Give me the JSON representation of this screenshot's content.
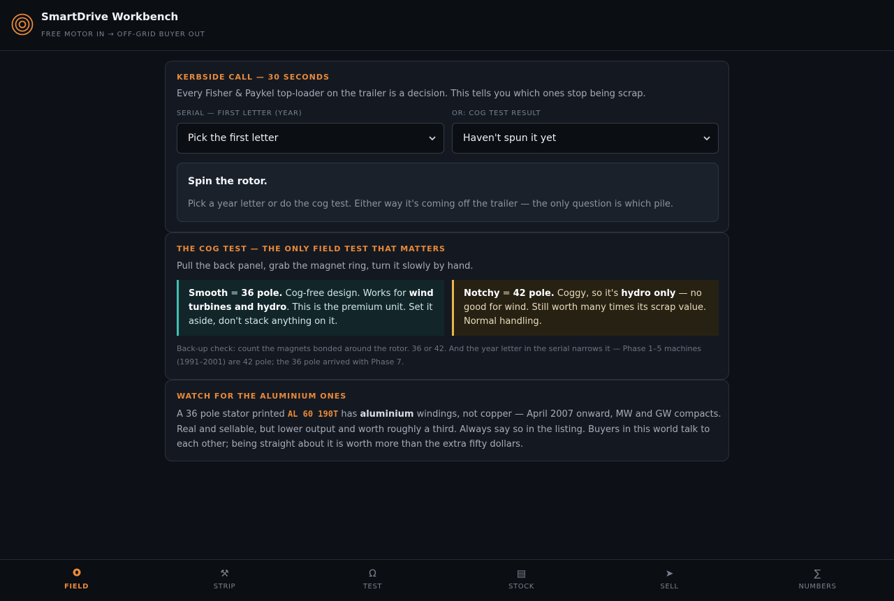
{
  "app": {
    "title": "SmartDrive Workbench",
    "subtitle": "FREE MOTOR IN → OFF-GRID BUYER OUT"
  },
  "colors": {
    "accent": "#e8893a",
    "smooth": "#3fc0b0",
    "notchy": "#e8b74a"
  },
  "kerbside": {
    "kicker": "KERBSIDE CALL — 30 SECONDS",
    "description": "Every Fisher & Paykel top-loader on the trailer is a decision. This tells you which ones stop being scrap.",
    "serial_label": "SERIAL — FIRST LETTER (YEAR)",
    "serial_value": "Pick the first letter",
    "cog_label": "OR: COG TEST RESULT",
    "cog_value": "Haven't spun it yet",
    "result_title": "Spin the rotor.",
    "result_text": "Pick a year letter or do the cog test. Either way it's coming off the trailer — the only question is which pile."
  },
  "cog_test": {
    "kicker": "THE COG TEST — THE ONLY FIELD TEST THAT MATTERS",
    "description": "Pull the back panel, grab the magnet ring, turn it slowly by hand.",
    "smooth": {
      "lead": "Smooth",
      "eq": " = ",
      "pole": "36 pole.",
      "t1": " Cog-free design. Works for ",
      "strong": "wind turbines and hydro",
      "t2": ". This is the premium unit. Set it aside, don't stack anything on it."
    },
    "notchy": {
      "lead": "Notchy",
      "eq": " = ",
      "pole": "42 pole.",
      "t1": " Coggy, so it's ",
      "strong": "hydro only",
      "t2": " — no good for wind. Still worth many times its scrap value. Normal handling."
    },
    "note": "Back-up check: count the magnets bonded around the rotor. 36 or 42. And the year letter in the serial narrows it — Phase 1–5 machines (1991–2001) are 42 pole; the 36 pole arrived with Phase 7."
  },
  "aluminium": {
    "kicker": "WATCH FOR THE ALUMINIUM ONES",
    "t1": "A 36 pole stator printed ",
    "code": "AL 60 190T",
    "t2": " has ",
    "strong": "aluminium",
    "t3": " windings, not copper — April 2007 onward, MW and GW compacts. Real and sellable, but lower output and worth roughly a third. Always say so in the listing. Buyers in this world talk to each other; being straight about it is worth more than the extra fifty dollars."
  },
  "nav": {
    "items": [
      {
        "label": "FIELD",
        "icon": "●"
      },
      {
        "label": "STRIP",
        "icon": "⚒"
      },
      {
        "label": "TEST",
        "icon": "Ω"
      },
      {
        "label": "STOCK",
        "icon": "▤"
      },
      {
        "label": "SELL",
        "icon": "➤"
      },
      {
        "label": "NUMBERS",
        "icon": "∑"
      }
    ],
    "active": "FIELD"
  }
}
